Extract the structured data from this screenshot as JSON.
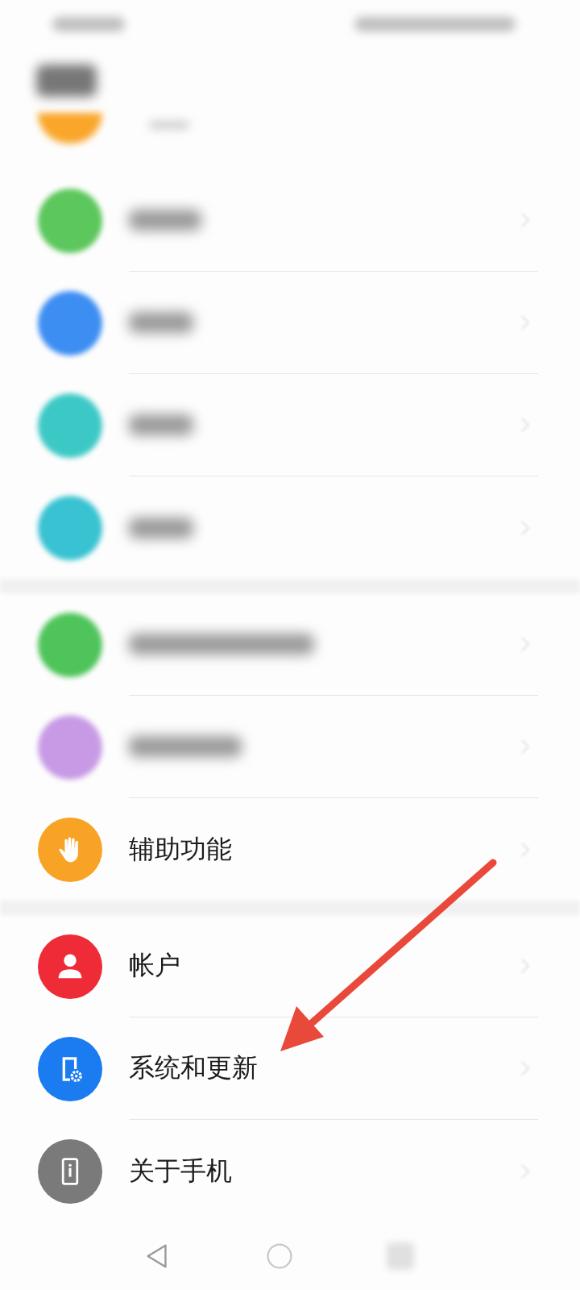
{
  "groups": [
    {
      "items": [
        {
          "kind": "blurred",
          "color": "#5cc75c"
        },
        {
          "kind": "blurred",
          "color": "#3d8ef2"
        },
        {
          "kind": "blurred",
          "color": "#3cc9c6"
        },
        {
          "kind": "blurred",
          "color": "#38c2d2"
        }
      ]
    },
    {
      "items": [
        {
          "kind": "blurred",
          "color": "#4ec45a"
        },
        {
          "kind": "blurred",
          "color": "#c89ae6"
        },
        {
          "kind": "hand",
          "color": "#f8a326",
          "label": "辅助功能"
        }
      ]
    },
    {
      "items": [
        {
          "kind": "person",
          "color": "#ee2b37",
          "label": "帐户"
        },
        {
          "kind": "phone-gear",
          "color": "#1a7cf0",
          "label": "系统和更新"
        },
        {
          "kind": "phone-info",
          "color": "#7a7a7a",
          "label": "关于手机"
        }
      ]
    }
  ]
}
